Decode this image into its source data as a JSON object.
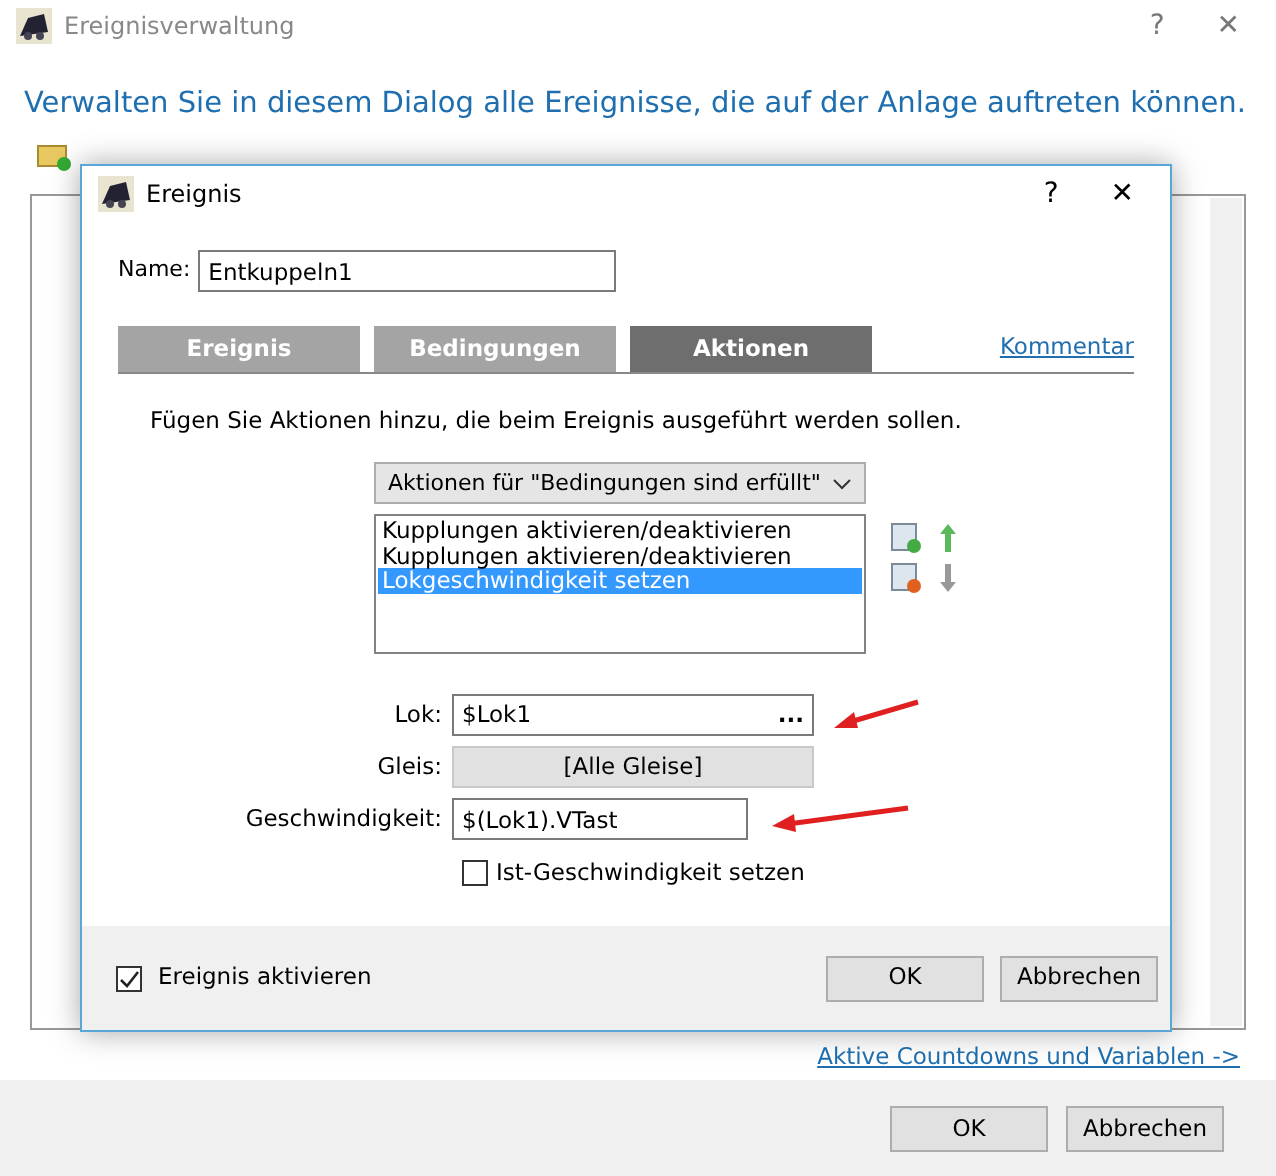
{
  "window": {
    "title": "Ereignisverwaltung",
    "help": "?",
    "close": "✕"
  },
  "heading": "Verwalten Sie in diesem Dialog alle Ereignisse, die auf der Anlage auftreten können.",
  "link": "Aktive Countdowns und Variablen ->",
  "buttons": [
    {
      "label": "OK"
    },
    {
      "label": "Abbrechen"
    }
  ],
  "dialog": {
    "title": "Ereignis",
    "help": "?",
    "close": "✕",
    "name_label": "Name:",
    "name_value": "Entkuppeln1",
    "tabs": [
      {
        "label": "Ereignis",
        "selected": false
      },
      {
        "label": "Bedingungen",
        "selected": false
      },
      {
        "label": "Aktionen",
        "selected": true
      }
    ],
    "comment_link": "Kommentar",
    "description": "Fügen Sie Aktionen hinzu, die beim Ereignis ausgeführt werden sollen.",
    "dropdown": "Aktionen für \"Bedingungen sind erfüllt\"",
    "actions": [
      {
        "label": "Kupplungen aktivieren/deaktivieren",
        "selected": false
      },
      {
        "label": "Kupplungen aktivieren/deaktivieren",
        "selected": false
      },
      {
        "label": "Lokgeschwindigkeit setzen",
        "selected": true
      }
    ],
    "lok_label": "Lok:",
    "lok_value": "$Lok1",
    "lok_browse": "...",
    "gleis_label": "Gleis:",
    "gleis_button": "[Alle Gleise]",
    "speed_label": "Geschwindigkeit:",
    "speed_value": "$(Lok1).VTast",
    "actual_speed": {
      "label": "Ist-Geschwindigkeit setzen",
      "checked": false
    },
    "enable": {
      "label": "Ereignis aktivieren",
      "checked": true
    },
    "buttons": [
      {
        "label": "OK"
      },
      {
        "label": "Abbrechen"
      }
    ]
  }
}
